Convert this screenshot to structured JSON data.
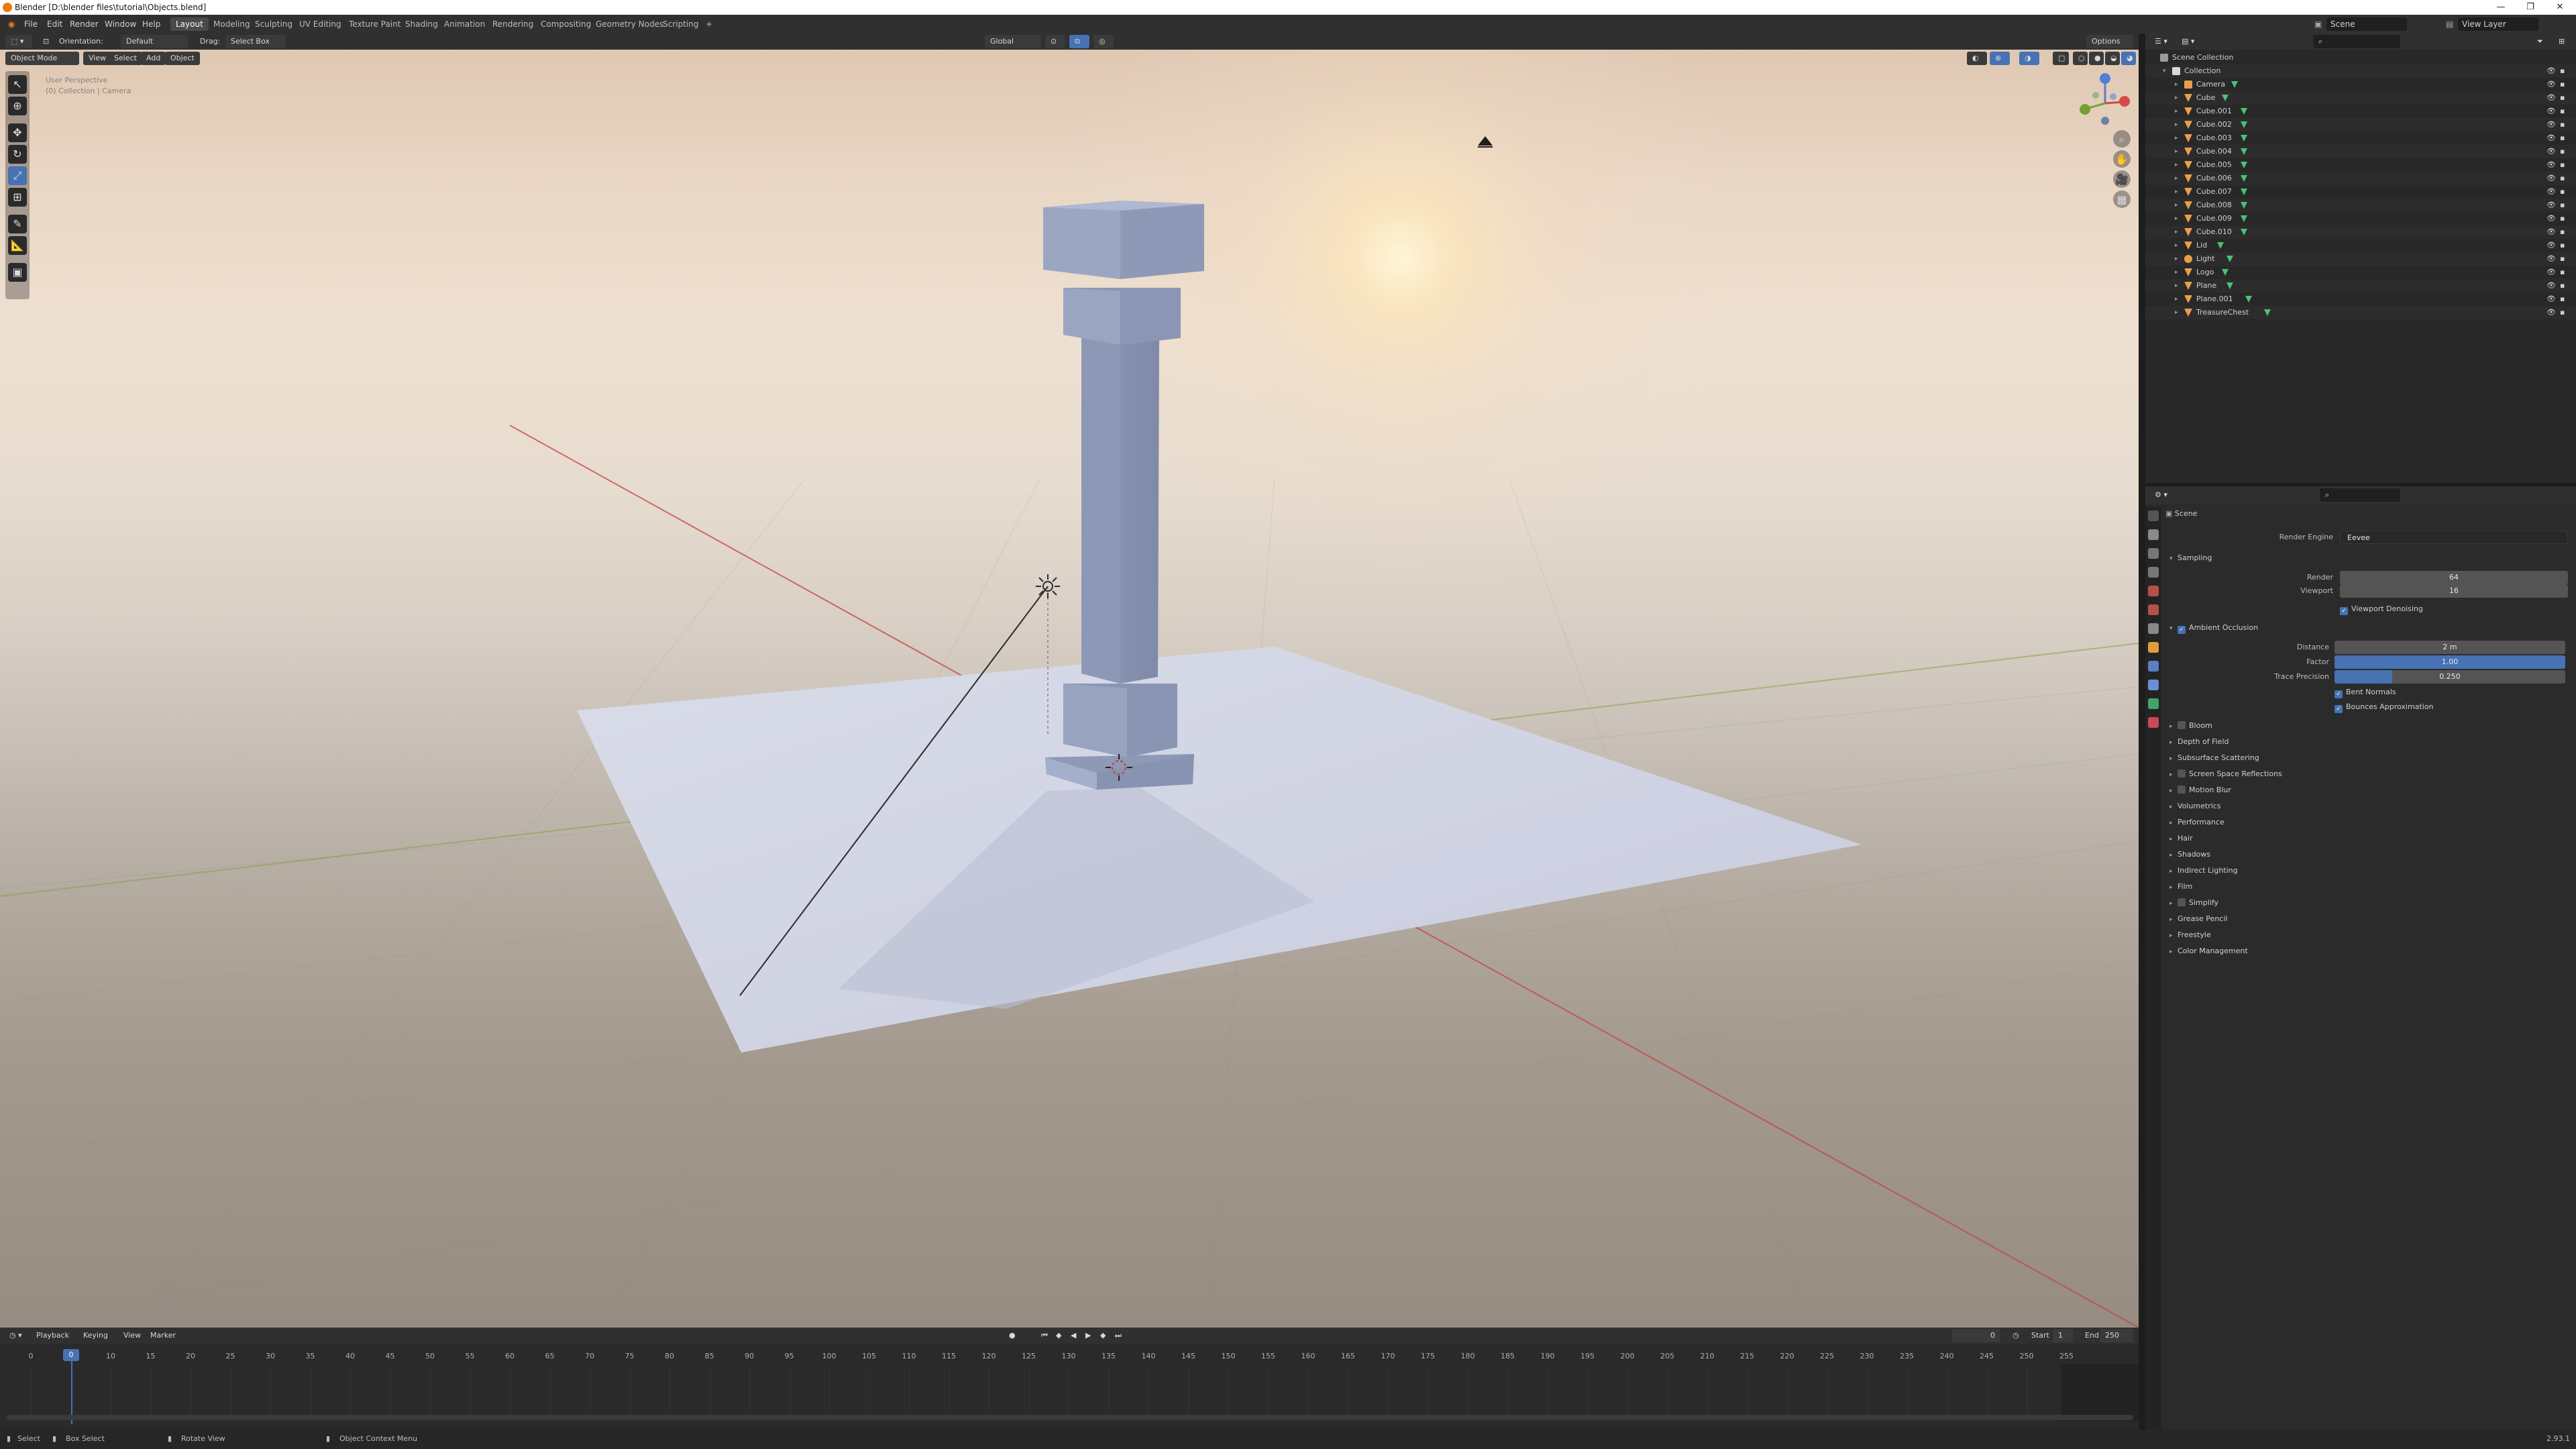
{
  "window": {
    "title": "Blender [D:\\blender files\\tutorial\\Objects.blend]"
  },
  "menu": [
    "File",
    "Edit",
    "Render",
    "Window",
    "Help"
  ],
  "workspaces": [
    "Layout",
    "Modeling",
    "Sculpting",
    "UV Editing",
    "Texture Paint",
    "Shading",
    "Animation",
    "Rendering",
    "Compositing",
    "Geometry Nodes",
    "Scripting",
    "+"
  ],
  "active_workspace": "Layout",
  "scene_name": "Scene",
  "view_layer": "View Layer",
  "tool_header": {
    "orientation": "Orientation:",
    "orientation_value": "Default",
    "drag": "Drag:",
    "drag_value": "Select Box",
    "transform": "Global",
    "options": "Options"
  },
  "viewport_header": {
    "mode": "Object Mode",
    "menus": [
      "View",
      "Select",
      "Add",
      "Object"
    ]
  },
  "viewport_overlay": {
    "line1": "User Perspective",
    "line2": "(0) Collection | Camera"
  },
  "outliner": {
    "rows": [
      {
        "name": "Scene Collection",
        "indent": 0,
        "type": "scene"
      },
      {
        "name": "Collection",
        "indent": 1,
        "type": "collection"
      },
      {
        "name": "Camera",
        "indent": 2,
        "type": "camera"
      },
      {
        "name": "Cube",
        "indent": 2,
        "type": "mesh"
      },
      {
        "name": "Cube.001",
        "indent": 2,
        "type": "mesh"
      },
      {
        "name": "Cube.002",
        "indent": 2,
        "type": "mesh"
      },
      {
        "name": "Cube.003",
        "indent": 2,
        "type": "mesh"
      },
      {
        "name": "Cube.004",
        "indent": 2,
        "type": "mesh"
      },
      {
        "name": "Cube.005",
        "indent": 2,
        "type": "mesh"
      },
      {
        "name": "Cube.006",
        "indent": 2,
        "type": "mesh"
      },
      {
        "name": "Cube.007",
        "indent": 2,
        "type": "mesh"
      },
      {
        "name": "Cube.008",
        "indent": 2,
        "type": "mesh"
      },
      {
        "name": "Cube.009",
        "indent": 2,
        "type": "mesh"
      },
      {
        "name": "Cube.010",
        "indent": 2,
        "type": "mesh"
      },
      {
        "name": "Lid",
        "indent": 2,
        "type": "mesh"
      },
      {
        "name": "Light",
        "indent": 2,
        "type": "light"
      },
      {
        "name": "Logo",
        "indent": 2,
        "type": "mesh"
      },
      {
        "name": "Plane",
        "indent": 2,
        "type": "mesh"
      },
      {
        "name": "Plane.001",
        "indent": 2,
        "type": "mesh"
      },
      {
        "name": "TreasureChest",
        "indent": 2,
        "type": "mesh"
      }
    ]
  },
  "properties": {
    "context": "Scene",
    "render_engine_label": "Render Engine",
    "render_engine": "Eevee",
    "sampling": {
      "title": "Sampling",
      "render_label": "Render",
      "render": "64",
      "viewport_label": "Viewport",
      "viewport": "16",
      "denoise": "Viewport Denoising"
    },
    "ao": {
      "title": "Ambient Occlusion",
      "distance_label": "Distance",
      "distance": "2 m",
      "factor_label": "Factor",
      "factor": "1.00",
      "factor_fill": 1.0,
      "trace_label": "Trace Precision",
      "trace": "0.250",
      "trace_fill": 0.25,
      "bent": "Bent Normals",
      "bounce": "Bounces Approximation"
    },
    "sections": [
      "Bloom",
      "Depth of Field",
      "Subsurface Scattering",
      "Screen Space Reflections",
      "Motion Blur",
      "Volumetrics",
      "Performance",
      "Hair",
      "Shadows",
      "Indirect Lighting",
      "Film",
      "Simplify",
      "Grease Pencil",
      "Freestyle",
      "Color Management"
    ]
  },
  "timeline": {
    "menus": [
      "Playback",
      "Keying",
      "View",
      "Marker"
    ],
    "current_frame": "0",
    "start_label": "Start",
    "start": "1",
    "end_label": "End",
    "end": "250",
    "ticks": [
      "0",
      "5",
      "10",
      "15",
      "20",
      "25",
      "30",
      "35",
      "40",
      "45",
      "50",
      "55",
      "60",
      "65",
      "70",
      "75",
      "80",
      "85",
      "90",
      "95",
      "100",
      "105",
      "110",
      "115",
      "120",
      "125",
      "130",
      "135",
      "140",
      "145",
      "150",
      "155",
      "160",
      "165",
      "170",
      "175",
      "180",
      "185",
      "190",
      "195",
      "200",
      "205",
      "210",
      "215",
      "220",
      "225",
      "230",
      "235",
      "240",
      "245",
      "250",
      "255"
    ]
  },
  "status": {
    "select": "Select",
    "box_select": "Box Select",
    "rotate": "Rotate View",
    "context": "Object Context Menu",
    "version": "2.93.1"
  },
  "colors": {
    "accent": "#4772b3",
    "header": "#303030",
    "panel": "#2b2b2b",
    "mesh_icon": "#e89f4a",
    "data_icon": "#4bc17a"
  }
}
